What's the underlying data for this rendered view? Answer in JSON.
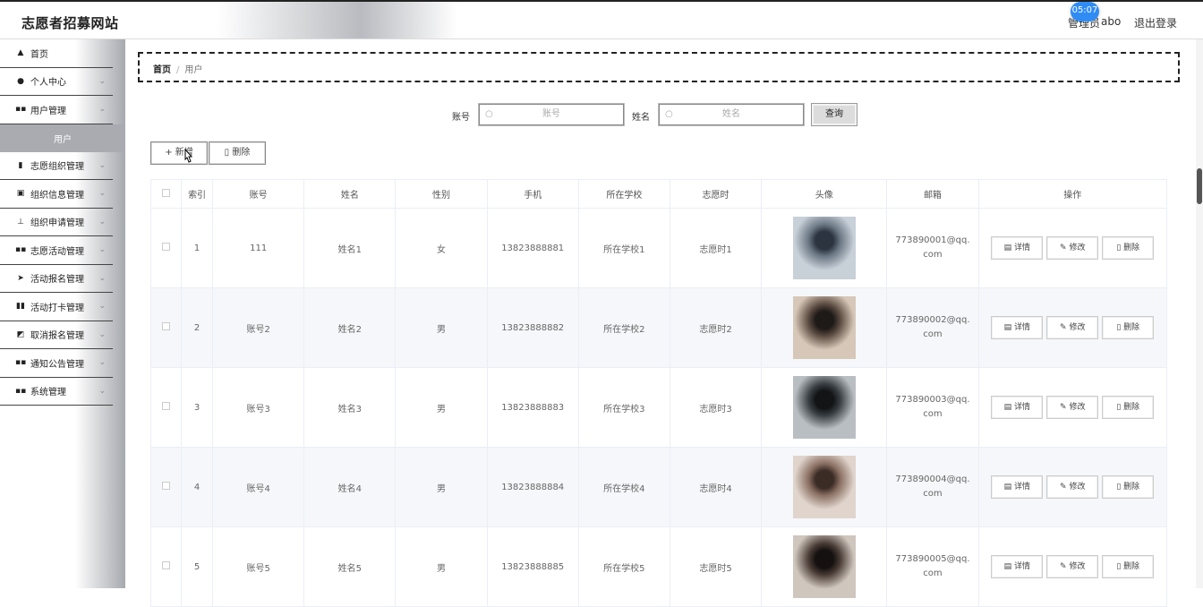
{
  "header": {
    "brand": "志愿者招募网站",
    "user_role": "管理员",
    "user_name": "abo",
    "logout_label": "退出登录",
    "time_badge": "05:07"
  },
  "sidebar": {
    "items": [
      {
        "label": "首页",
        "icon": "home-icon",
        "glyph": "▲"
      },
      {
        "label": "个人中心",
        "icon": "user-icon",
        "glyph": "●"
      },
      {
        "label": "用户管理",
        "icon": "grid-icon",
        "glyph": "▪▪"
      },
      {
        "label": "志愿组织管理",
        "icon": "chart-icon",
        "glyph": "▮"
      },
      {
        "label": "组织信息管理",
        "icon": "doc-icon",
        "glyph": "▣"
      },
      {
        "label": "组织申请管理",
        "icon": "upload-icon",
        "glyph": "⊥"
      },
      {
        "label": "志愿活动管理",
        "icon": "grid-icon",
        "glyph": "▪▪"
      },
      {
        "label": "活动报名管理",
        "icon": "send-icon",
        "glyph": "➤"
      },
      {
        "label": "活动打卡管理",
        "icon": "bar-icon",
        "glyph": "▮▮"
      },
      {
        "label": "取消报名管理",
        "icon": "edit-icon",
        "glyph": "◩"
      },
      {
        "label": "通知公告管理",
        "icon": "grid-icon",
        "glyph": "▪▪"
      },
      {
        "label": "系统管理",
        "icon": "grid-icon",
        "glyph": "▪▪"
      }
    ],
    "sub_item": "用户"
  },
  "breadcrumb": {
    "home": "首页",
    "separator": "/",
    "current": "用户"
  },
  "search": {
    "account_label": "账号",
    "account_placeholder": "账号",
    "name_label": "姓名",
    "name_placeholder": "姓名",
    "query_label": "查询"
  },
  "actions": {
    "add_label": "+ 新增",
    "delete_label": "删除"
  },
  "table": {
    "headers": [
      "",
      "索引",
      "账号",
      "姓名",
      "性别",
      "手机",
      "所在学校",
      "志愿时",
      "头像",
      "邮箱",
      "操作"
    ],
    "op_labels": {
      "detail": "详情",
      "edit": "修改",
      "delete": "删除"
    },
    "rows": [
      {
        "index": "1",
        "account": "111",
        "name": "姓名1",
        "gender": "女",
        "phone": "13823888881",
        "school": "所在学校1",
        "hours": "志愿时1",
        "email": "773890001@qq.com",
        "avatar_colors": [
          "#c8d0d8",
          "#6b7784",
          "#2c3440"
        ]
      },
      {
        "index": "2",
        "account": "账号2",
        "name": "姓名2",
        "gender": "男",
        "phone": "13823888882",
        "school": "所在学校2",
        "hours": "志愿时2",
        "email": "773890002@qq.com",
        "avatar_colors": [
          "#d6c7b8",
          "#5a4a40",
          "#1e1a18"
        ]
      },
      {
        "index": "3",
        "account": "账号3",
        "name": "姓名3",
        "gender": "男",
        "phone": "13823888883",
        "school": "所在学校3",
        "hours": "志愿时3",
        "email": "773890003@qq.com",
        "avatar_colors": [
          "#b9bec2",
          "#3a3f44",
          "#121416"
        ]
      },
      {
        "index": "4",
        "account": "账号4",
        "name": "姓名4",
        "gender": "男",
        "phone": "13823888884",
        "school": "所在学校4",
        "hours": "志愿时4",
        "email": "773890004@qq.com",
        "avatar_colors": [
          "#e0d4cc",
          "#8a6f62",
          "#3b2c26"
        ]
      },
      {
        "index": "5",
        "account": "账号5",
        "name": "姓名5",
        "gender": "男",
        "phone": "13823888885",
        "school": "所在学校5",
        "hours": "志愿时5",
        "email": "773890005@qq.com",
        "avatar_colors": [
          "#cfc6be",
          "#4a3c36",
          "#141110"
        ]
      }
    ]
  }
}
